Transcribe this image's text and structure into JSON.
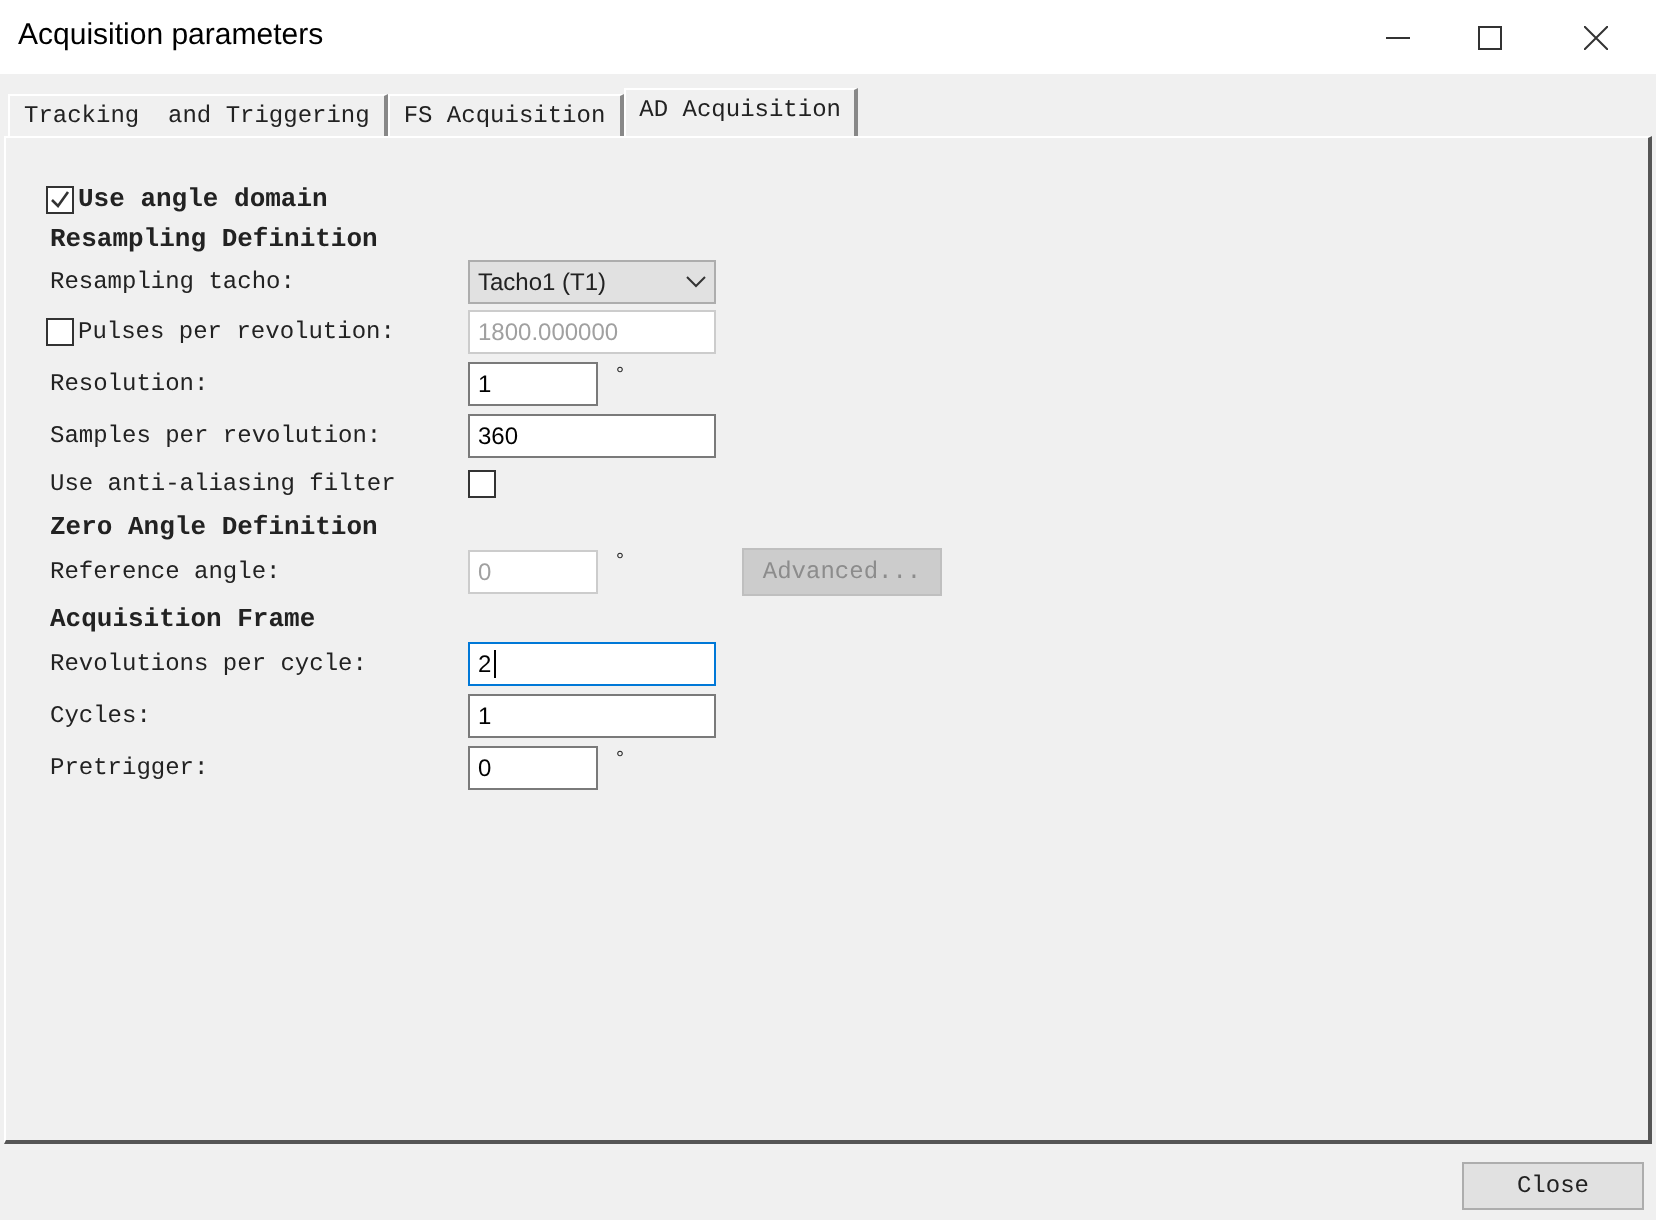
{
  "window": {
    "title": "Acquisition parameters"
  },
  "tabs": [
    {
      "label": "Tracking  and Triggering",
      "selected": false
    },
    {
      "label": "FS Acquisition",
      "selected": false
    },
    {
      "label": "AD Acquisition",
      "selected": true
    }
  ],
  "use_angle_domain": {
    "label": "Use angle domain",
    "checked": true
  },
  "rows": [
    {
      "kind": "heading",
      "label": "Resampling Definition"
    },
    {
      "kind": "dropdown",
      "label": "Resampling tacho:",
      "value": "Tacho1 (T1)"
    },
    {
      "kind": "check-field",
      "label": "Pulses per revolution:",
      "checked": false,
      "value": "1800.000000",
      "disabled": true
    },
    {
      "kind": "short-field",
      "label": "Resolution:",
      "value": "1",
      "unit": "°",
      "disabled": false
    },
    {
      "kind": "field",
      "label": "Samples per revolution:",
      "value": "360",
      "disabled": false
    },
    {
      "kind": "checkbox",
      "label": "Use anti-aliasing filter",
      "checked": false
    },
    {
      "kind": "heading",
      "label": "Zero Angle Definition"
    },
    {
      "kind": "short-field",
      "label": "Reference angle:",
      "value": "0",
      "unit": "°",
      "disabled": true,
      "button": {
        "label": "Advanced...",
        "disabled": true
      }
    },
    {
      "kind": "heading",
      "label": "Acquisition Frame"
    },
    {
      "kind": "field",
      "label": "Revolutions per cycle:",
      "value": "2",
      "disabled": false,
      "focused": true
    },
    {
      "kind": "field",
      "label": "Cycles:",
      "value": "1",
      "disabled": false
    },
    {
      "kind": "short-field",
      "label": "Pretrigger:",
      "value": "0",
      "unit": "°",
      "disabled": false
    }
  ],
  "buttons": [
    {
      "label": "Close"
    }
  ]
}
